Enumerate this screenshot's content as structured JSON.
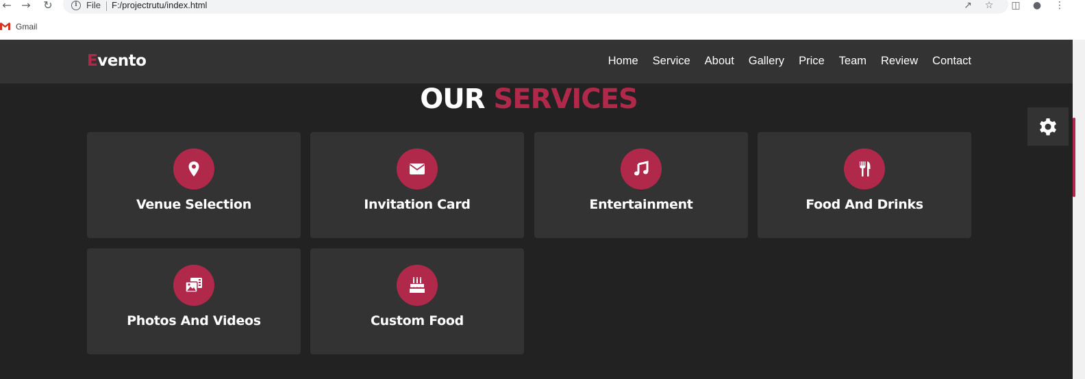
{
  "browser": {
    "file_label": "File",
    "url": "F:/projectrutu/index.html",
    "bookmark_gmail": "Gmail"
  },
  "site": {
    "logo_first": "E",
    "logo_rest": "vento",
    "nav": [
      "Home",
      "Service",
      "About",
      "Gallery",
      "Price",
      "Team",
      "Review",
      "Contact"
    ],
    "section_title_1": "OUR",
    "section_title_2": "SERVICES",
    "services": [
      {
        "title": "Venue Selection",
        "icon": "map-marker-icon"
      },
      {
        "title": "Invitation Card",
        "icon": "envelope-icon"
      },
      {
        "title": "Entertainment",
        "icon": "music-icon"
      },
      {
        "title": "Food And Drinks",
        "icon": "utensils-icon"
      },
      {
        "title": "Photos And Videos",
        "icon": "photo-video-icon"
      },
      {
        "title": "Custom Food",
        "icon": "birthday-cake-icon"
      }
    ]
  },
  "colors": {
    "accent": "#b1294a",
    "background": "#222222",
    "card": "#333333"
  }
}
